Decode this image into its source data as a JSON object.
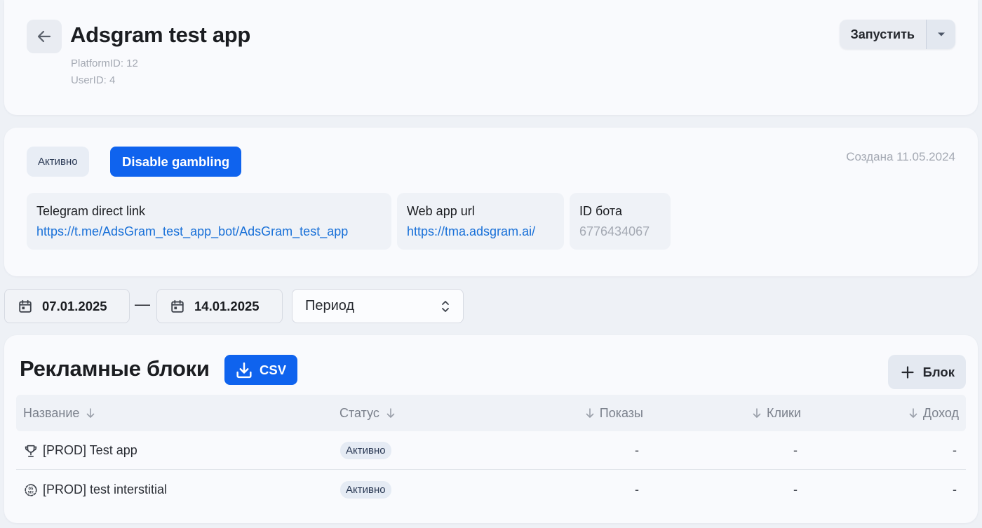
{
  "header": {
    "title": "Adsgram test app",
    "platform_id": "PlatformID: 12",
    "user_id": "UserID: 4",
    "launch_label": "Запустить"
  },
  "info": {
    "status": "Активно",
    "gambling_button": "Disable gambling",
    "created": "Создана 11.05.2024",
    "telegram_label": "Telegram direct link",
    "telegram_value": "https://t.me/AdsGram_test_app_bot/AdsGram_test_app",
    "webapp_label": "Web app url",
    "webapp_value": "https://tma.adsgram.ai/",
    "bot_label": "ID бота",
    "bot_value": "6776434067"
  },
  "filters": {
    "date_from": "07.01.2025",
    "separator": "—",
    "date_to": "14.01.2025",
    "period": "Период"
  },
  "blocks": {
    "title": "Рекламные блоки",
    "csv_label": "CSV",
    "add_label": "Блок",
    "columns": {
      "name": "Название",
      "status": "Статус",
      "shows": "Показы",
      "clicks": "Клики",
      "income": "Доход"
    },
    "rows": [
      {
        "icon": "trophy-icon",
        "name": "[PROD] Test app",
        "status": "Активно",
        "shows": "-",
        "clicks": "-",
        "income": "-"
      },
      {
        "icon": "timer-5s-icon",
        "name": "[PROD] test interstitial",
        "status": "Активно",
        "shows": "-",
        "clicks": "-",
        "income": "-"
      }
    ]
  },
  "colors": {
    "primary": "#0f63ee",
    "link": "#1870d8",
    "muted": "#a4a9b3",
    "background": "#eef1f6"
  }
}
